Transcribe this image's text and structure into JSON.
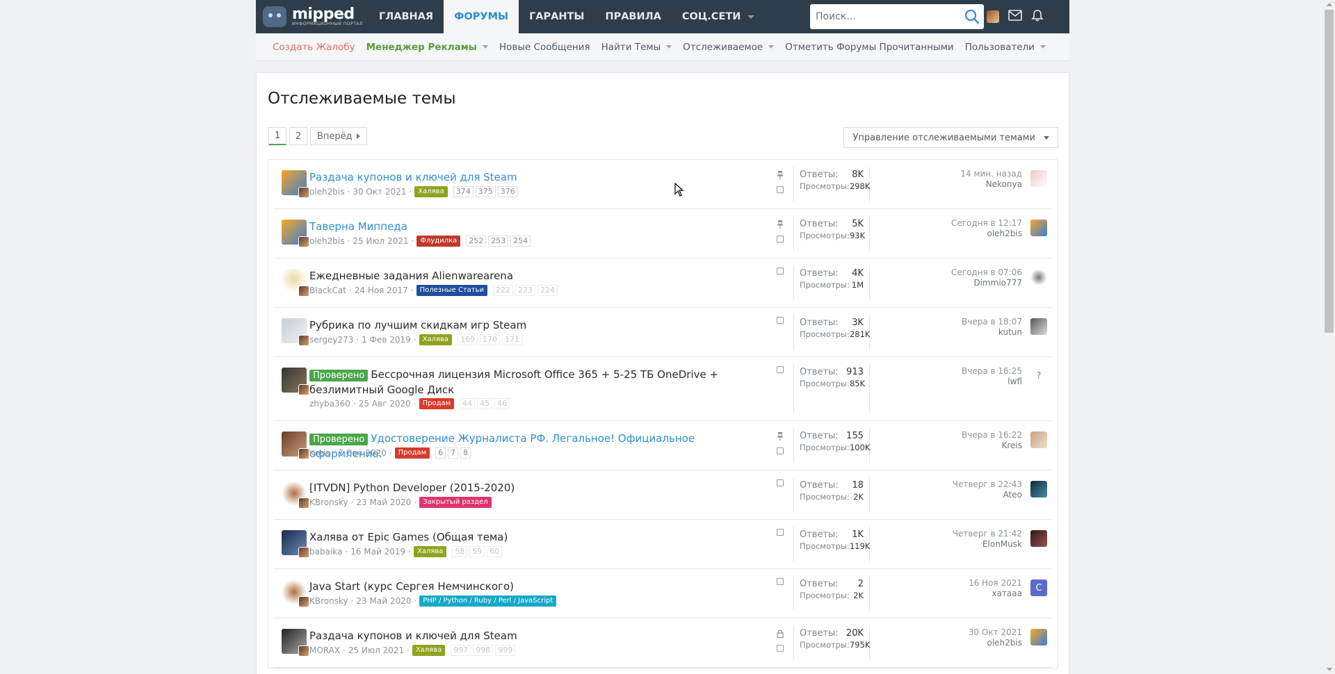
{
  "logo": {
    "name": "mipped",
    "sub": "ИНФОРМАЦИОННЫЙ ПОРТАЛ"
  },
  "topnav": {
    "tabs": [
      {
        "label": "ГЛАВНАЯ"
      },
      {
        "label": "ФОРУМЫ"
      },
      {
        "label": "ГАРАНТЫ"
      },
      {
        "label": "ПРАВИЛА"
      },
      {
        "label": "СОЦ.СЕТИ"
      }
    ],
    "search_placeholder": "Поиск..."
  },
  "subnav": {
    "items": [
      {
        "label": "Создать Жалобу"
      },
      {
        "label": "Менеджер Рекламы"
      },
      {
        "label": "Новые Сообщения"
      },
      {
        "label": "Найти Темы"
      },
      {
        "label": "Отслеживаемое"
      },
      {
        "label": "Отметить Форумы Прочитанными"
      },
      {
        "label": "Пользователи"
      }
    ]
  },
  "page": {
    "title": "Отслеживаемые темы",
    "pager": {
      "p1": "1",
      "p2": "2",
      "next": "Вперёд"
    },
    "manage_label": "Управление отслеживаемыми темами"
  },
  "labels": {
    "replies": "Ответы:",
    "views": "Просмотры:"
  },
  "threads": [
    {
      "title": "Раздача купонов и ключей для Steam",
      "author": "oleh2bis",
      "date": "30 Окт 2021",
      "prefix": "Халява",
      "prefix_color": "#8fa31e",
      "pages": [
        "374",
        "375",
        "376"
      ],
      "replies": "8K",
      "views": "298K",
      "last_time": "14 мин. назад",
      "last_user": "Nekonya",
      "unread": true
    },
    {
      "title": "Таверна Миппеда",
      "author": "oleh2bis",
      "date": "25 Июл 2021",
      "prefix": "Флудилка",
      "prefix_color": "#c0392b",
      "pages": [
        "252",
        "253",
        "254"
      ],
      "replies": "5K",
      "views": "93K",
      "last_time": "Сегодня в 12:17",
      "last_user": "oleh2bis",
      "unread": true
    },
    {
      "title": "Ежедневные задания Alienwarearena",
      "author": "BlackCat",
      "date": "24 Ноя 2017",
      "prefix": "Полезные Статьи",
      "prefix_color": "#1f4f9c",
      "pages": [
        "222",
        "223",
        "224"
      ],
      "replies": "4K",
      "views": "1M",
      "last_time": "Сегодня в 07:06",
      "last_user": "Dimmio777",
      "unread": false
    },
    {
      "title": "Рубрика по лучшим скидкам игр Steam",
      "author": "sergey273",
      "date": "1 Фев 2019",
      "prefix": "Халява",
      "prefix_color": "#8fa31e",
      "pages": [
        "169",
        "170",
        "171"
      ],
      "replies": "3K",
      "views": "281K",
      "last_time": "Вчера в 18:07",
      "last_user": "kutun",
      "unread": false
    },
    {
      "badge": "Проверено",
      "title": "Бессрочная лицензия Microsoft Office 365 + 5-25 ТБ OneDrive + безлимитный Google Диск",
      "author": "zhyba360",
      "date": "25 Авг 2020",
      "prefix": "Продам",
      "prefix_color": "#d93b2b",
      "pages": [
        "44",
        "45",
        "46"
      ],
      "replies": "913",
      "views": "85K",
      "last_time": "Вчера в 16:25",
      "last_user": "lwfl",
      "last_avatar": "?",
      "unread": false
    },
    {
      "badge": "Проверено",
      "title": "Удостоверение Журналиста РФ. Легальное! Официальное оформление.",
      "author": "Kreis",
      "date": "7 Сен 2020",
      "prefix": "Продам",
      "prefix_color": "#d93b2b",
      "pages": [
        "6",
        "7",
        "8"
      ],
      "replies": "155",
      "views": "100K",
      "last_time": "Вчера в 16:22",
      "last_user": "Kreis",
      "unread": true
    },
    {
      "title": "[ITVDN] Python Developer (2015-2020)",
      "author": "KBronsky",
      "date": "23 Май 2020",
      "prefix": "Закрытый раздел",
      "prefix_color": "#e0326e",
      "pages": [],
      "replies": "18",
      "views": "2K",
      "last_time": "Четверг в 22:43",
      "last_user": "Ateo",
      "unread": false
    },
    {
      "title": "Халява от Epic Games (Общая тема)",
      "author": "babaika",
      "date": "16 Май 2019",
      "prefix": "Халява",
      "prefix_color": "#8fa31e",
      "pages": [
        "58",
        "59",
        "60"
      ],
      "replies": "1K",
      "views": "119K",
      "last_time": "Четверг в 21:42",
      "last_user": "ElonMusk",
      "unread": false
    },
    {
      "title": "Java Start (курс Сергея Немчинского)",
      "author": "KBronsky",
      "date": "23 Май 2020",
      "prefix": "PHP / Python / Ruby / Perl / JavaScript",
      "prefix_color": "#17a8c8",
      "pages": [],
      "replies": "2",
      "views": "2K",
      "last_time": "16 Ноя 2021",
      "last_user": "хатааа",
      "last_avatar": "C",
      "unread": false
    },
    {
      "title": "Раздача купонов и ключей для Steam",
      "author": "MORAX",
      "date": "25 Июл 2021",
      "prefix": "Халява",
      "prefix_color": "#8fa31e",
      "pages": [
        "997",
        "998",
        "999"
      ],
      "replies": "20K",
      "views": "795K",
      "last_time": "30 Окт 2021",
      "last_user": "oleh2bis",
      "unread": false
    }
  ],
  "colors": {
    "nav_bg": "#2e3d4a",
    "accent_blue": "#2f8fd1",
    "proven_green": "#4aa54b"
  }
}
